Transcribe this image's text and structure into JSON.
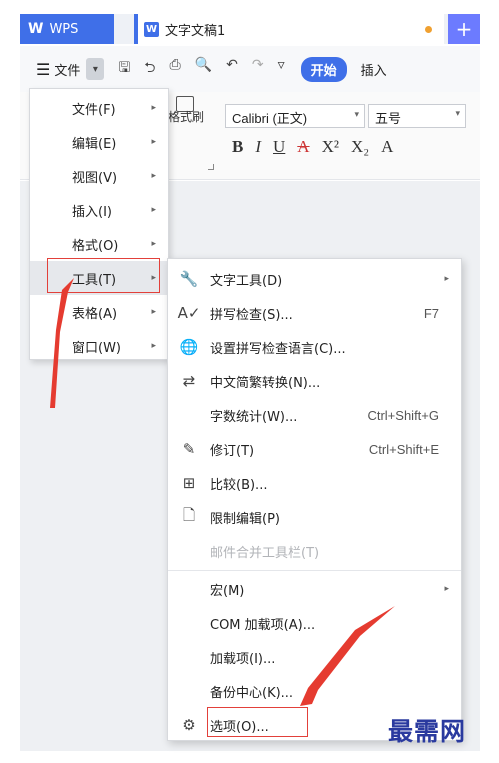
{
  "titlebar": {
    "app_name": "WPS",
    "doc_tab_title": "文字文稿1",
    "doc_icon": "W",
    "new_tab": "+"
  },
  "toolbar": {
    "menu_label": "文件",
    "start_button": "开始",
    "insert_tab": "插入",
    "icons": [
      "save-icon",
      "undo-history-icon",
      "print-icon",
      "print-preview-icon",
      "undo-icon",
      "redo-icon",
      "more-icon"
    ]
  },
  "ribbon": {
    "format_brush_label": "格式刷",
    "font_name": "Calibri (正文)",
    "font_size": "五号",
    "format_buttons": [
      "B",
      "I",
      "U",
      "A",
      "X²",
      "X₂",
      "A"
    ]
  },
  "main_menu": {
    "items": [
      {
        "label": "文件(F)",
        "has_submenu": true
      },
      {
        "label": "编辑(E)",
        "has_submenu": true
      },
      {
        "label": "视图(V)",
        "has_submenu": true
      },
      {
        "label": "插入(I)",
        "has_submenu": true
      },
      {
        "label": "格式(O)",
        "has_submenu": true
      },
      {
        "label": "工具(T)",
        "has_submenu": true,
        "active": true
      },
      {
        "label": "表格(A)",
        "has_submenu": true
      },
      {
        "label": "窗口(W)",
        "has_submenu": true
      }
    ]
  },
  "tools_menu": {
    "items": [
      {
        "label": "文字工具(D)",
        "icon": "wrench-icon",
        "shortcut": "",
        "has_submenu": true
      },
      {
        "label": "拼写检查(S)...",
        "icon": "spell-check-icon",
        "shortcut": "F7"
      },
      {
        "label": "设置拼写检查语言(C)...",
        "icon": "language-globe-icon",
        "shortcut": ""
      },
      {
        "label": "中文简繁转换(N)...",
        "icon": "convert-icon",
        "shortcut": ""
      },
      {
        "label": "字数统计(W)...",
        "icon": "",
        "shortcut": "Ctrl+Shift+G"
      },
      {
        "label": "修订(T)",
        "icon": "revision-icon",
        "shortcut": "Ctrl+Shift+E"
      },
      {
        "label": "比较(B)...",
        "icon": "compare-icon",
        "shortcut": ""
      },
      {
        "label": "限制编辑(P)",
        "icon": "restrict-edit-icon",
        "shortcut": ""
      },
      {
        "label": "邮件合并工具栏(T)",
        "icon": "",
        "shortcut": "",
        "disabled": true
      },
      {
        "label": "宏(M)",
        "icon": "",
        "shortcut": "",
        "has_submenu": true
      },
      {
        "label": "COM 加载项(A)...",
        "icon": "",
        "shortcut": ""
      },
      {
        "label": "加载项(I)...",
        "icon": "",
        "shortcut": ""
      },
      {
        "label": "备份中心(K)...",
        "icon": "",
        "shortcut": ""
      },
      {
        "label": "选项(O)...",
        "icon": "gear-icon",
        "shortcut": ""
      }
    ]
  },
  "watermark": "最需网",
  "colors": {
    "accent": "#3f6fe8",
    "highlight": "#e2403a"
  }
}
